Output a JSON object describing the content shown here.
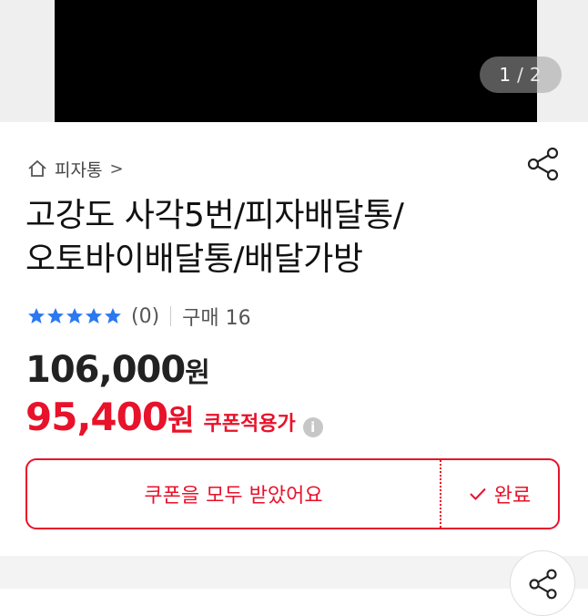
{
  "gallery": {
    "current_page": "1",
    "separator": "/",
    "total_pages": "2"
  },
  "breadcrumb": {
    "category": "피자통",
    "chevron": ">"
  },
  "product": {
    "title_line1": "고강도 사각5번/피자배달통/",
    "title_line2": "오토바이배달통/배달가방"
  },
  "rating": {
    "stars": 5,
    "review_count": "(0)",
    "purchase_label": "구매 16"
  },
  "price": {
    "original_amount": "106,000",
    "original_unit": "원",
    "coupon_amount": "95,400",
    "coupon_unit": "원",
    "coupon_label": "쿠폰적용가",
    "info_icon_text": "i"
  },
  "coupon_bar": {
    "receive_label": "쿠폰을 모두 받았어요",
    "done_label": "완료"
  },
  "colors": {
    "accent": "#e8122a",
    "star": "#2a79f0"
  },
  "icons": [
    "home-icon",
    "share-icon",
    "star-icon",
    "info-icon",
    "check-icon"
  ]
}
